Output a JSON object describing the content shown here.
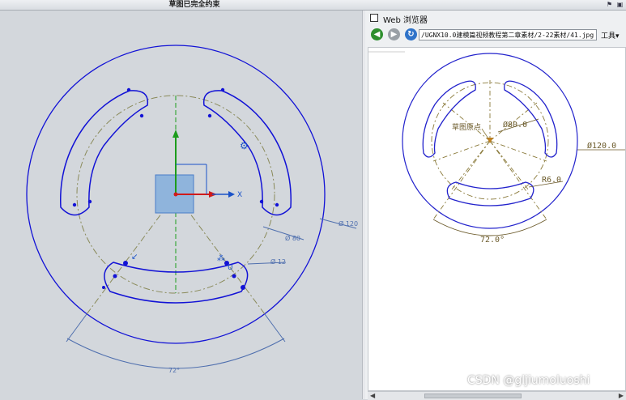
{
  "window": {
    "title": "草图已完全约束",
    "buttons": [
      "⚑",
      "▣"
    ]
  },
  "sketch": {
    "colors": {
      "curve": "#1212d6",
      "centerline": "#8a8a5a",
      "dimension": "#4f6fae",
      "axis_green": "#1c9c1c",
      "axis_red": "#d01a1a",
      "axis_blue": "#1a52c8",
      "box_fill": "#8fb4dc"
    },
    "axis_x_label": "X",
    "dimensions": {
      "outer_diameter": "Ø 120",
      "pitch_diameter": "Ø 80",
      "slot_width": "Ø 12",
      "angle": "72°"
    }
  },
  "web_panel": {
    "title": "Web 浏览器",
    "url": "/UGNX10.0建模篇视频教程第二章素材/2-22素材/41.jpg",
    "tools_label": "工具",
    "nav_icons": [
      "back-icon",
      "forward-icon",
      "refresh-icon"
    ],
    "image_labels": {
      "origin": "草图原点",
      "pitch_diameter": "Ø80.0",
      "outer_diameter": "Ø120.0",
      "radius": "R6.0",
      "angle": "72.0°"
    }
  },
  "watermark": "CSDN @gljiumoluoshi"
}
